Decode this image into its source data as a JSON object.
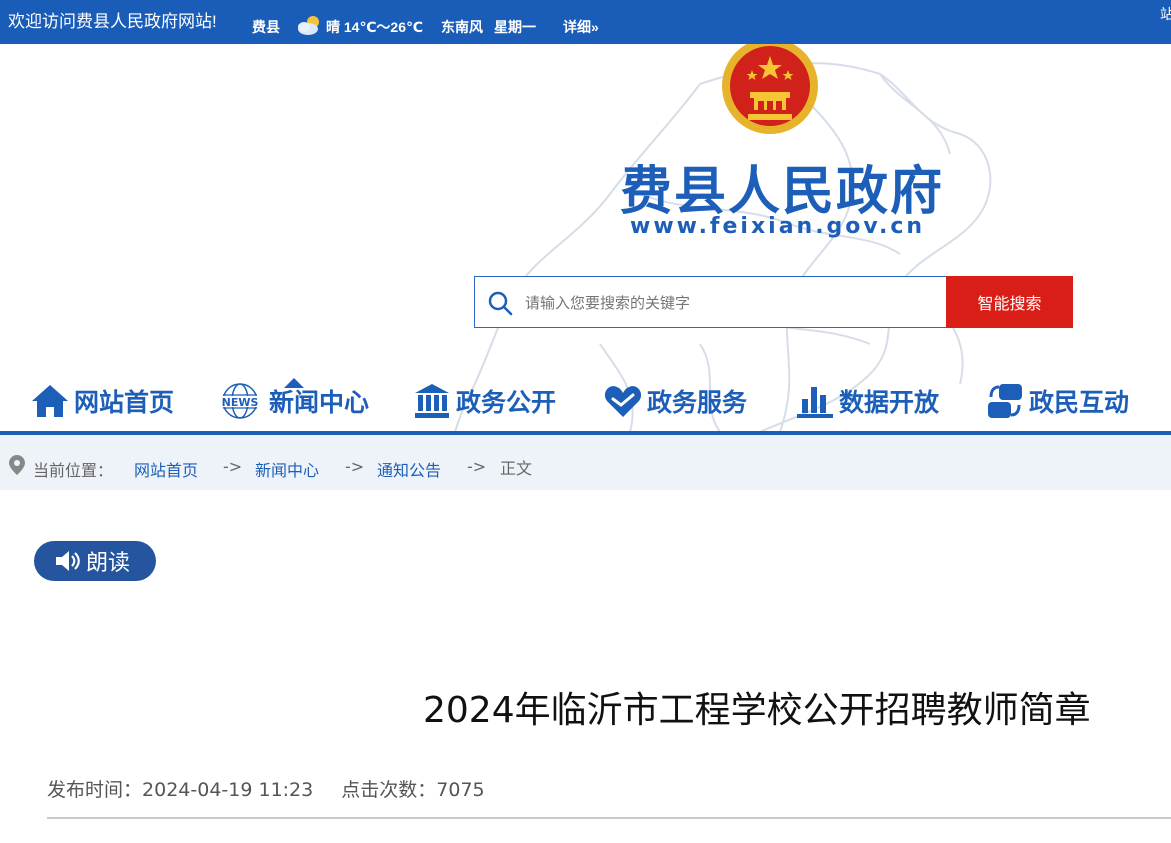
{
  "topbar": {
    "welcome": "欢迎访问费县人民政府网站!",
    "city": "费县",
    "weather_icon": "partly-cloudy-icon",
    "condition": "晴 14℃～26℃",
    "wind": "东南风",
    "weekday": "星期一",
    "detail_link": "详细»",
    "edge_text": "🔲"
  },
  "header": {
    "emblem": "national-emblem-icon",
    "site_title": "费县人民政府",
    "site_url": "www.feixian.gov.cn"
  },
  "search": {
    "placeholder": "请输入您要搜索的关键字",
    "value": "",
    "button_label": "智能搜索"
  },
  "nav": {
    "items": [
      {
        "label": "网站首页",
        "icon": "home-icon"
      },
      {
        "label": "新闻中心",
        "icon": "news-globe-icon"
      },
      {
        "label": "政务公开",
        "icon": "government-building-icon"
      },
      {
        "label": "政务服务",
        "icon": "heart-service-icon"
      },
      {
        "label": "数据开放",
        "icon": "bar-chart-icon"
      },
      {
        "label": "政民互动",
        "icon": "interaction-icon"
      }
    ],
    "active_index": 1
  },
  "breadcrumb": {
    "label": "当前位置：",
    "items": [
      "网站首页",
      "新闻中心",
      "通知公告"
    ],
    "separator": "->",
    "current": "正文"
  },
  "read_button": {
    "label": "朗读",
    "icon": "speaker-icon"
  },
  "article": {
    "title": "2024年临沂市工程学校公开招聘教师简章",
    "publish_label": "发布时间：",
    "publish_time": "2024-04-19 11:23",
    "hits_label": "点击次数：",
    "hits": "7075"
  },
  "colors": {
    "primary": "#1d5fb8",
    "topbar": "#1a5db8",
    "search_button": "#d91e18",
    "read_button": "#24559e",
    "breadcrumb_bg": "#eef3fa"
  }
}
